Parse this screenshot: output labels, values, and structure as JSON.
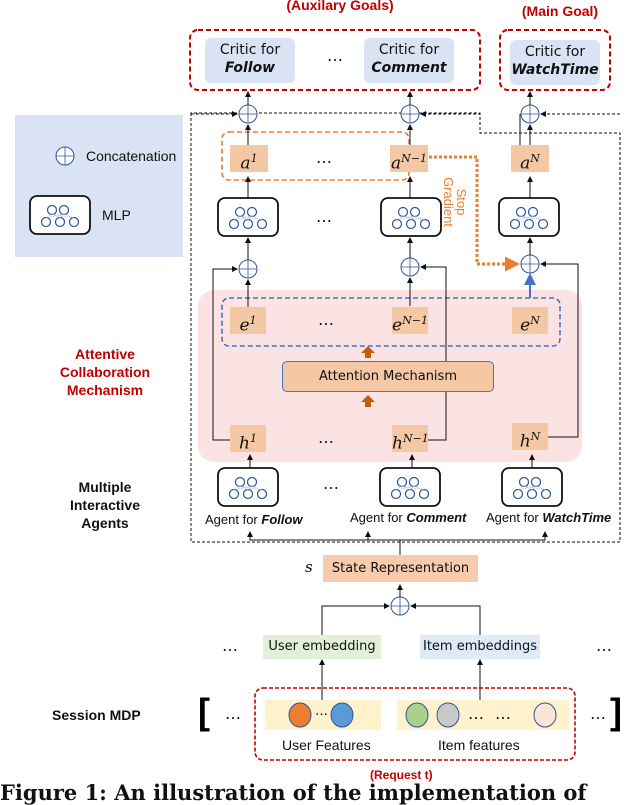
{
  "titles": {
    "auxiliary_goals": "(Auxilary Goals)",
    "main_goal": "(Main Goal)",
    "request": "(Request t)"
  },
  "critics": [
    {
      "prefix": "Critic for",
      "target": "Follow"
    },
    {
      "prefix": "Critic for",
      "target": "Comment"
    },
    {
      "prefix": "Critic for",
      "target": "WatchTime"
    }
  ],
  "legend": {
    "concat_label": "Concatenation",
    "mlp_label": "MLP"
  },
  "actions": [
    {
      "base": "a",
      "sup": "1"
    },
    {
      "base": "a",
      "sup": "N−1"
    },
    {
      "base": "a",
      "sup": "N"
    }
  ],
  "embeddings": [
    {
      "base": "e",
      "sup": "1"
    },
    {
      "base": "e",
      "sup": "N−1"
    },
    {
      "base": "e",
      "sup": "N"
    }
  ],
  "hidden": [
    {
      "base": "h",
      "sup": "1"
    },
    {
      "base": "h",
      "sup": "N−1"
    },
    {
      "base": "h",
      "sup": "N"
    }
  ],
  "stop_gradient": [
    "Stop",
    "Gradient"
  ],
  "attention_label": "Attention Mechanism",
  "section_labels": {
    "attentive": [
      "Attentive",
      "Collaboration",
      "Mechanism"
    ],
    "agents": [
      "Multiple",
      "Interactive",
      "Agents"
    ],
    "session": "Session MDP"
  },
  "agents": [
    {
      "prefix": "Agent for",
      "target": "Follow"
    },
    {
      "prefix": "Agent for",
      "target": "Comment"
    },
    {
      "prefix": "Agent for",
      "target": "WatchTime"
    }
  ],
  "state": {
    "symbol": "s",
    "label": "State Representation"
  },
  "embeddings_row": {
    "user": "User embedding",
    "item": "Item embeddings"
  },
  "features": {
    "user": "User Features",
    "item": "Item features"
  },
  "ellipsis": "…",
  "brackets": {
    "open": "[",
    "close": "]"
  },
  "colors": {
    "critic_fill": "#dae3f3",
    "square_fill": "#f4c7a5",
    "attention_bg": "#fbe3e4",
    "red": "#c00000",
    "orange": "#ed7d31",
    "blue": "#4472c4"
  },
  "caption": "Figure 1: An illustration of the implementation of"
}
